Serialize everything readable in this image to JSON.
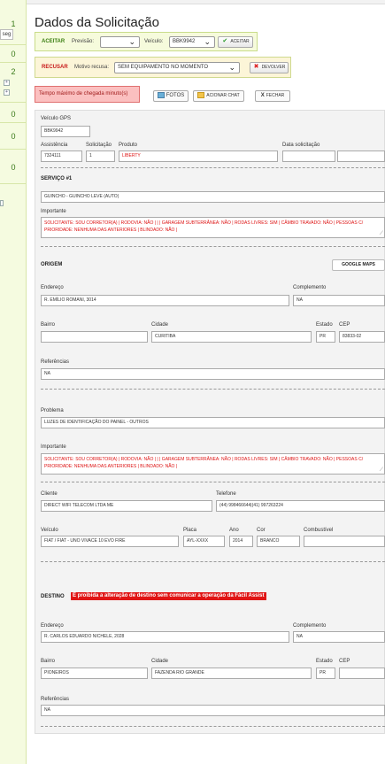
{
  "sidebar": {
    "items": [
      {
        "value": "1",
        "unit": "seg"
      },
      {
        "value": "0"
      },
      {
        "value": "2"
      },
      {
        "value": "0"
      },
      {
        "value": "0"
      },
      {
        "value": "0"
      }
    ]
  },
  "page": {
    "title": "Dados da Solicitação"
  },
  "accept": {
    "label": "ACEITAR",
    "forecast_label": "Previsão:",
    "forecast_value": "",
    "vehicle_label": "Veículo:",
    "vehicle_value": "BBK9942",
    "button": "ACEITAR"
  },
  "refuse": {
    "label": "RECUSAR",
    "reason_label": "Motivo recusa:",
    "reason_value": "SEM EQUIPAMENTO NO MOMENTO",
    "button": "DEVOLVER"
  },
  "warning": {
    "text": "Tempo máximo de chegada minuto(s)"
  },
  "actions": {
    "photos": "FOTOS",
    "chat": "ACIONAR CHAT",
    "close": "FECHAR"
  },
  "form": {
    "vehicle_gps": {
      "label": "Veículo GPS",
      "value": "BBK9942"
    },
    "assistance": {
      "label": "Assistência",
      "value": "7324111"
    },
    "request": {
      "label": "Solicitação",
      "value": "1"
    },
    "product": {
      "label": "Produto",
      "value": "LIBERTY"
    },
    "request_date": {
      "label": "Data solicitação",
      "value": ""
    },
    "service": {
      "title": "SERVIÇO #1",
      "value": "GUINCHO - GUINCHO LEVE (AUTO)",
      "important_label": "Importante",
      "important_text": "SOLICITANTE: SOU CORRETOR(A) | RODOVIA: NÃO | | | GARAGEM SUBTERRÂNEA: NÃO | RODAS LIVRES: SIM | CÂMBIO TRAVADO: NÃO | PESSOAS C/ PRIORIDADE: NENHUMA DAS ANTERIORES | BLINDADO: NÃO |"
    },
    "origin": {
      "title": "ORIGEM",
      "maps_button": "GOOGLE MAPS",
      "address_label": "Endereço",
      "address": "R. EMÍLIO ROMANI, 3014",
      "complement_label": "Complemento",
      "complement": "NA",
      "district_label": "Bairro",
      "district": "",
      "city_label": "Cidade",
      "city": "CURITIBA",
      "state_label": "Estado",
      "state": "PR",
      "zip_label": "CEP",
      "zip": "83833-02",
      "references_label": "Referências",
      "references": "NA",
      "problem_label": "Problema",
      "problem": "LUZES DE IDENTIFICAÇÃO DO PAINEL - OUTROS",
      "important_label": "Importante",
      "important_text": "SOLICITANTE: SOU CORRETOR(A) | RODOVIA: NÃO | | | GARAGEM SUBTERRÂNEA: NÃO | RODAS LIVRES: SIM | CÂMBIO TRAVADO: NÃO | PESSOAS C/ PRIORIDADE: NENHUMA DAS ANTERIORES | BLINDADO: NÃO |",
      "client_label": "Cliente",
      "client": "DIRECT WIFI TELECOM LTDA ME",
      "phone_label": "Telefone",
      "phone": "(44) 998466644|(41) 997263224",
      "vehicle_label": "Veículo",
      "vehicle": "FIAT / FIAT - UNO VIVACE 10 EVO FIRE",
      "plate_label": "Placa",
      "plate": "AYL-XXXX",
      "year_label": "Ano",
      "year": "2014",
      "color_label": "Cor",
      "color": "BRANCO",
      "fuel_label": "Combustível",
      "fuel": ""
    },
    "destination": {
      "title": "DESTINO",
      "warning": "É proibida a alteração de destino sem comunicar a operação da Fácil Assist",
      "address_label": "Endereço",
      "address": "R. CARLOS EDUARDO NICHELE, 2028",
      "complement_label": "Complemento",
      "complement": "NA",
      "district_label": "Bairro",
      "district": "PIONEIROS",
      "city_label": "Cidade",
      "city": "FAZENDA RIO GRANDE",
      "state_label": "Estado",
      "state": "PR",
      "zip_label": "CEP",
      "zip": "",
      "references_label": "Referências",
      "references": "NA"
    }
  }
}
